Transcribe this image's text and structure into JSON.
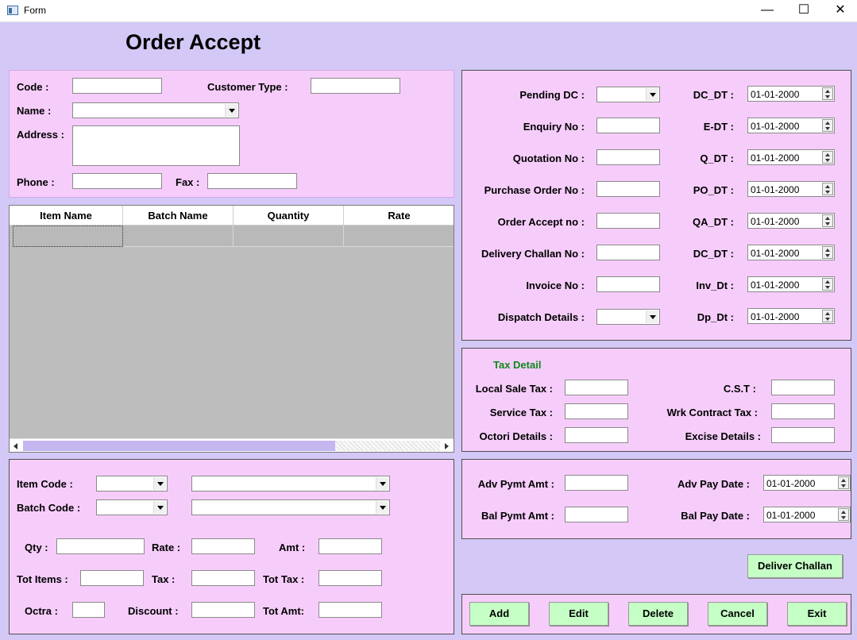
{
  "window": {
    "title": "Form",
    "minimize": "—",
    "maximize": "☐",
    "close": "✕"
  },
  "heading": "Order Accept",
  "customer": {
    "code_label": "Code :",
    "customer_type_label": "Customer Type :",
    "name_label": "Name :",
    "address_label": "Address :",
    "phone_label": "Phone :",
    "fax_label": "Fax :"
  },
  "grid": {
    "columns": [
      "Item Name",
      "Batch Name",
      "Quantity",
      "Rate"
    ]
  },
  "item_entry": {
    "item_code_label": "Item Code   :",
    "batch_code_label": "Batch Code :",
    "qty_label": "Qty :",
    "rate_label": "Rate :",
    "amt_label": "Amt :",
    "tot_items_label": "Tot Items :",
    "tax_label": "Tax   :",
    "tot_tax_label": "Tot Tax :",
    "octra_label": "Octra :",
    "discount_label": "Discount  :",
    "tot_amt_label": "Tot Amt:"
  },
  "documents": {
    "pending_dc_label": "Pending DC :",
    "enquiry_no_label": "Enquiry No  :",
    "quotation_no_label": "Quotation No :",
    "purchase_order_label": "Purchase Order  No :",
    "order_accept_label": "Order Accept no   :",
    "delivery_challan_label": "Delivery Challan No  :",
    "invoice_no_label": "Invoice No :",
    "dispatch_details_label": "Dispatch Details :",
    "dc_dt_label": "DC_DT  :",
    "e_dt_label": "E-DT  :",
    "q_dt_label": "Q_DT  :",
    "po_dt_label": "PO_DT  :",
    "qa_dt_label": "QA_DT  :",
    "dc_dt2_label": "DC_DT  :",
    "inv_dt_label": "Inv_Dt  :",
    "dp_dt_label": "Dp_Dt  :",
    "dc_dt_value": "01-01-2000",
    "e_dt_value": "01-01-2000",
    "q_dt_value": "01-01-2000",
    "po_dt_value": "01-01-2000",
    "qa_dt_value": "01-01-2000",
    "dc_dt2_value": "01-01-2000",
    "inv_dt_value": "01-01-2000",
    "dp_dt_value": "01-01-2000"
  },
  "tax": {
    "title": "Tax Detail",
    "local_sale_tax_label": "Local Sale Tax :",
    "service_tax_label": "Service Tax  :",
    "octori_details_label": "Octori Details :",
    "cst_label": "C.S.T :",
    "wrk_contract_tax_label": "Wrk Contract Tax :",
    "excise_details_label": "Excise Details   :"
  },
  "payment": {
    "adv_pymt_amt_label": "Adv Pymt Amt :",
    "bal_pymt_amt_label": "Bal Pymt Amt :",
    "adv_pay_date_label": "Adv Pay Date  :",
    "bal_pay_date_label": "Bal Pay Date  :",
    "adv_pay_date_value": "01-01-2000",
    "bal_pay_date_value": "01-01-2000"
  },
  "buttons": {
    "deliver_challan": "Deliver Challan",
    "add": "Add",
    "edit": "Edit",
    "delete": "Delete",
    "cancel": "Cancel",
    "exit": "Exit"
  },
  "colors": {
    "form_bg": "#d4c8f6",
    "panel_bg": "#f6cdfa",
    "button_bg": "#c6ffc6",
    "tax_title": "#11881a"
  }
}
